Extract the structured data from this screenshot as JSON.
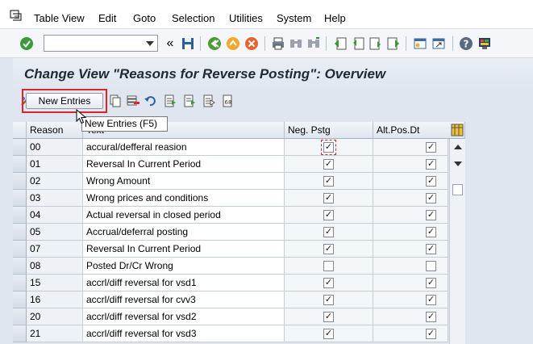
{
  "menu": {
    "items": [
      "Table View",
      "Edit",
      "Goto",
      "Selection",
      "Utilities",
      "System",
      "Help"
    ]
  },
  "toolbar": {
    "command_value": "",
    "icons": [
      "enter-icon",
      "back-icon",
      "save-icon",
      "back-arrow-icon",
      "exit-icon",
      "cancel-icon",
      "print-icon",
      "find-icon",
      "find-next-icon",
      "first-page-icon",
      "previous-page-icon",
      "next-page-icon",
      "last-page-icon",
      "create-session-icon",
      "shortcut-icon",
      "help-icon",
      "customize-layout-icon"
    ]
  },
  "title": "Change View \"Reasons for Reverse Posting\": Overview",
  "app_toolbar": {
    "new_entries_label": "New Entries",
    "tooltip": "New Entries   (F5)"
  },
  "table": {
    "headers": {
      "reason": "Reason",
      "text": "Text",
      "neg_pstg": "Neg. Pstg",
      "alt_pos_dt": "Alt.Pos.Dt"
    },
    "rows": [
      {
        "reason": "00",
        "text": "accural/defferal reasion",
        "neg": true,
        "alt": true
      },
      {
        "reason": "01",
        "text": "Reversal In Current Period",
        "neg": true,
        "alt": true
      },
      {
        "reason": "02",
        "text": "Wrong Amount",
        "neg": true,
        "alt": true
      },
      {
        "reason": "03",
        "text": "Wrong prices and conditions",
        "neg": true,
        "alt": true
      },
      {
        "reason": "04",
        "text": "Actual reversal in closed period",
        "neg": true,
        "alt": true
      },
      {
        "reason": "05",
        "text": "Accrual/deferral posting",
        "neg": true,
        "alt": true
      },
      {
        "reason": "07",
        "text": "Reversal In Current Period",
        "neg": true,
        "alt": true
      },
      {
        "reason": "08",
        "text": "Posted Dr/Cr Wrong",
        "neg": false,
        "alt": false
      },
      {
        "reason": "15",
        "text": "accrl/diff reversal for vsd1",
        "neg": true,
        "alt": true
      },
      {
        "reason": "16",
        "text": "accrl/diff reversal for cvv3",
        "neg": true,
        "alt": true
      },
      {
        "reason": "20",
        "text": "accrl/diff reversal for vsd2",
        "neg": true,
        "alt": true
      },
      {
        "reason": "21",
        "text": "accrl/diff reversal for vsd3",
        "neg": true,
        "alt": true
      }
    ]
  },
  "colors": {
    "accent_red": "#d9262b",
    "background": "#dfe6ef"
  }
}
